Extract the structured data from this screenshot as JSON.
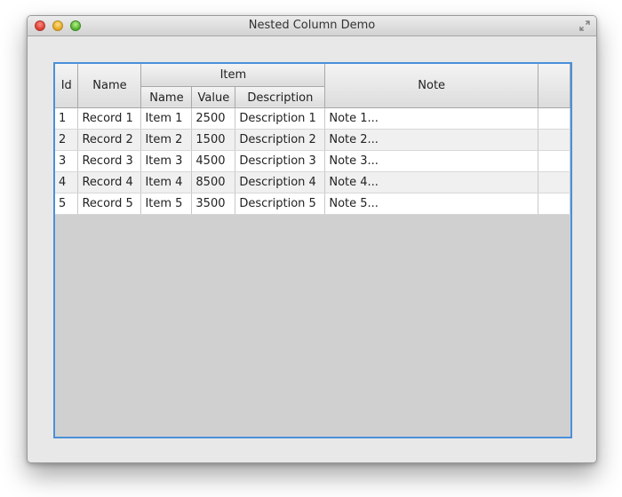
{
  "window": {
    "title": "Nested Column Demo"
  },
  "table": {
    "headers": {
      "id": "Id",
      "name": "Name",
      "item_group": "Item",
      "item_name": "Name",
      "item_value": "Value",
      "item_description": "Description",
      "note": "Note"
    },
    "rows": [
      {
        "id": "1",
        "name": "Record 1",
        "item_name": "Item 1",
        "value": "2500",
        "description": "Description 1",
        "note": "Note 1..."
      },
      {
        "id": "2",
        "name": "Record 2",
        "item_name": "Item 2",
        "value": "1500",
        "description": "Description 2",
        "note": "Note 2..."
      },
      {
        "id": "3",
        "name": "Record 3",
        "item_name": "Item 3",
        "value": "4500",
        "description": "Description 3",
        "note": "Note 3..."
      },
      {
        "id": "4",
        "name": "Record 4",
        "item_name": "Item 4",
        "value": "8500",
        "description": "Description 4",
        "note": "Note 4..."
      },
      {
        "id": "5",
        "name": "Record 5",
        "item_name": "Item 5",
        "value": "3500",
        "description": "Description 5",
        "note": "Note 5..."
      }
    ]
  },
  "colors": {
    "focus_border": "#4a90d9",
    "empty_area": "#d0d0d0"
  },
  "icons": {
    "close": "close-icon",
    "minimize": "minimize-icon",
    "zoom": "zoom-icon",
    "fullscreen": "fullscreen-icon"
  }
}
